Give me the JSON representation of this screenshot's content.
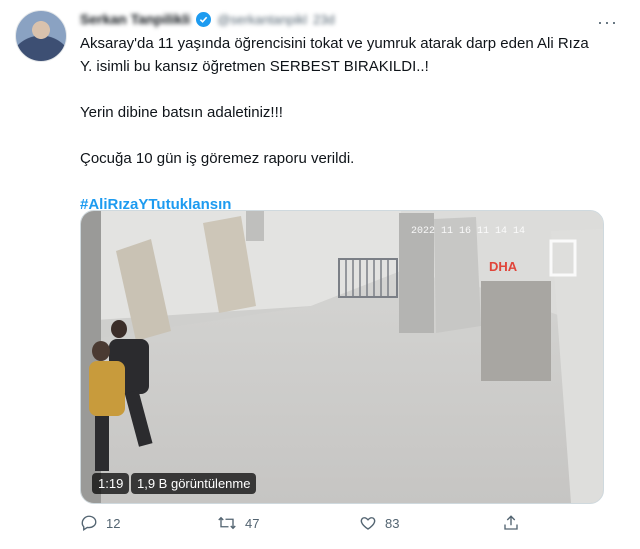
{
  "author": {
    "name": "Serkan Tanpilikli",
    "handle": "@serkantanpikl",
    "time": "23d"
  },
  "tweet": {
    "line1": "Aksaray'da 11 yaşında öğrencisini tokat ve yumruk atarak darp eden Ali Rıza",
    "line2": "Y. isimli bu kansız öğretmen SERBEST BIRAKILDI..!",
    "line3": "Yerin dibine batsın adaletiniz!!!",
    "line4": "Çocuğa 10 gün iş göremez raporu verildi.",
    "hashtag": "#AliRızaYTutuklansın"
  },
  "video": {
    "duration": "1:19",
    "views": "1,9 B görüntülenme",
    "timestamp_overlay": "2022 11 16 11 14 14",
    "watermark": "DHA"
  },
  "actions": {
    "replies": "12",
    "retweets": "47",
    "likes": "83"
  },
  "icons": [
    "more-icon",
    "verified-icon",
    "reply-icon",
    "retweet-icon",
    "like-icon",
    "share-icon"
  ],
  "colors": {
    "accent": "#1d9bf0",
    "text": "#0f1419",
    "muted": "#536471"
  }
}
